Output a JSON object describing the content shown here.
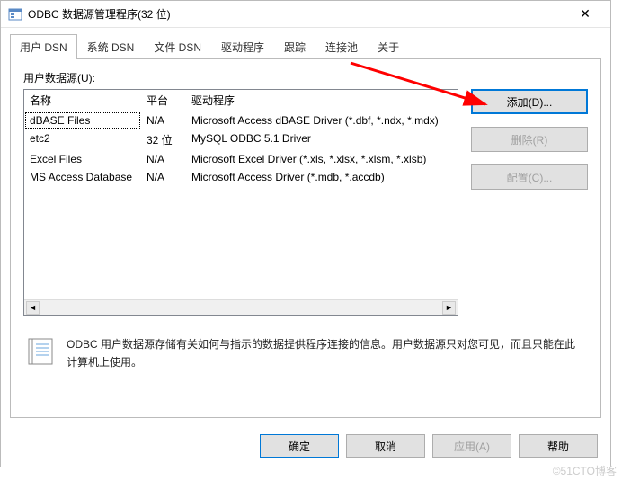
{
  "window": {
    "title": "ODBC 数据源管理程序(32 位)",
    "close": "✕"
  },
  "tabs": [
    "用户 DSN",
    "系统 DSN",
    "文件 DSN",
    "驱动程序",
    "跟踪",
    "连接池",
    "关于"
  ],
  "activeTab": 0,
  "dsnLabel": "用户数据源(U):",
  "columns": {
    "name": "名称",
    "platform": "平台",
    "driver": "驱动程序"
  },
  "rows": [
    {
      "name": "dBASE Files",
      "platform": "N/A",
      "driver": "Microsoft Access dBASE Driver (*.dbf, *.ndx, *.mdx)"
    },
    {
      "name": "etc2",
      "platform": "32 位",
      "driver": "MySQL ODBC 5.1 Driver"
    },
    {
      "name": "Excel Files",
      "platform": "N/A",
      "driver": "Microsoft Excel Driver (*.xls, *.xlsx, *.xlsm, *.xlsb)"
    },
    {
      "name": "MS Access Database",
      "platform": "N/A",
      "driver": "Microsoft Access Driver (*.mdb, *.accdb)"
    }
  ],
  "buttons": {
    "add": "添加(D)...",
    "remove": "删除(R)",
    "configure": "配置(C)..."
  },
  "scroll": {
    "left": "◄",
    "right": "►"
  },
  "info": "ODBC 用户数据源存储有关如何与指示的数据提供程序连接的信息。用户数据源只对您可见，而且只能在此计算机上使用。",
  "footer": {
    "ok": "确定",
    "cancel": "取消",
    "apply": "应用(A)",
    "help": "帮助"
  },
  "watermark": "©51CTO博客"
}
